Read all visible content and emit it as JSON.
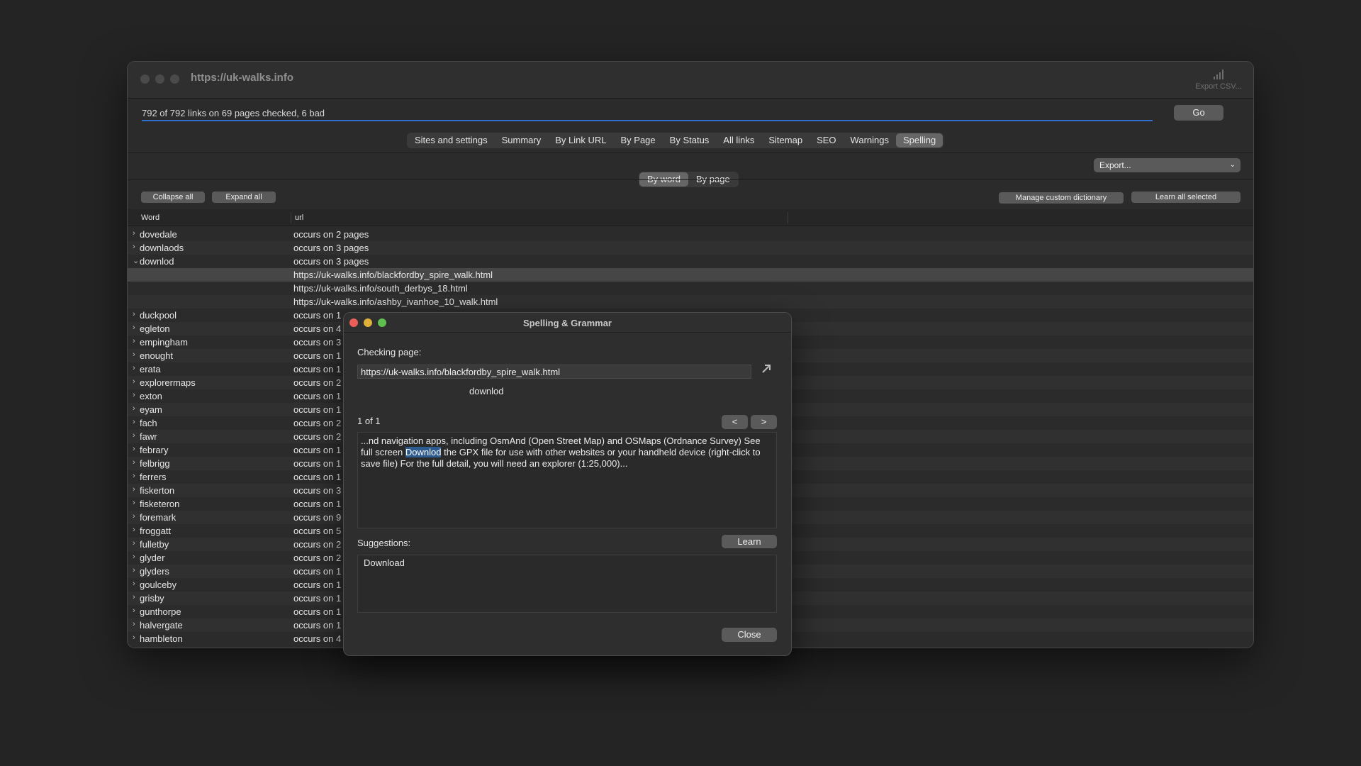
{
  "window": {
    "title": "https://uk-walks.info",
    "export_csv_label": "Export CSV...",
    "status": "792 of 792 links on 69 pages checked, 6 bad",
    "go_label": "Go"
  },
  "tabs": [
    "Sites and settings",
    "Summary",
    "By Link URL",
    "By Page",
    "By Status",
    "All links",
    "Sitemap",
    "SEO",
    "Warnings",
    "Spelling"
  ],
  "active_tab": "Spelling",
  "export_select": "Export...",
  "view_toggle": {
    "by_word": "By word",
    "by_page": "By page",
    "selected": "By word"
  },
  "buttons": {
    "collapse_all": "Collapse all",
    "expand_all": "Expand all",
    "manage_dictionary": "Manage custom dictionary",
    "learn_all_selected": "Learn all selected"
  },
  "columns": {
    "word": "Word",
    "url": "url"
  },
  "rows": [
    {
      "chev": "›",
      "word": "dovedale",
      "url": "occurs on 2 pages"
    },
    {
      "chev": "›",
      "word": "downlaods",
      "url": "occurs on 3 pages"
    },
    {
      "chev": "⌄",
      "word": "downlod",
      "url": "occurs on 3 pages"
    },
    {
      "chev": "",
      "word": "",
      "url": "https://uk-walks.info/blackfordby_spire_walk.html"
    },
    {
      "chev": "",
      "word": "",
      "url": "https://uk-walks.info/south_derbys_18.html"
    },
    {
      "chev": "",
      "word": "",
      "url": "https://uk-walks.info/ashby_ivanhoe_10_walk.html"
    },
    {
      "chev": "›",
      "word": "duckpool",
      "url": "occurs on 1"
    },
    {
      "chev": "›",
      "word": "egleton",
      "url": "occurs on 4"
    },
    {
      "chev": "›",
      "word": "empingham",
      "url": "occurs on 3"
    },
    {
      "chev": "›",
      "word": "enought",
      "url": "occurs on 1"
    },
    {
      "chev": "›",
      "word": "erata",
      "url": "occurs on 1"
    },
    {
      "chev": "›",
      "word": "explorermaps",
      "url": "occurs on 2"
    },
    {
      "chev": "›",
      "word": "exton",
      "url": "occurs on 1"
    },
    {
      "chev": "›",
      "word": "eyam",
      "url": "occurs on 1"
    },
    {
      "chev": "›",
      "word": "fach",
      "url": "occurs on 2"
    },
    {
      "chev": "›",
      "word": "fawr",
      "url": "occurs on 2"
    },
    {
      "chev": "›",
      "word": "febrary",
      "url": "occurs on 1"
    },
    {
      "chev": "›",
      "word": "felbrigg",
      "url": "occurs on 1"
    },
    {
      "chev": "›",
      "word": "ferrers",
      "url": "occurs on 1"
    },
    {
      "chev": "›",
      "word": "fiskerton",
      "url": "occurs on 3"
    },
    {
      "chev": "›",
      "word": "fisketeron",
      "url": "occurs on 1"
    },
    {
      "chev": "›",
      "word": "foremark",
      "url": "occurs on 9"
    },
    {
      "chev": "›",
      "word": "froggatt",
      "url": "occurs on 5"
    },
    {
      "chev": "›",
      "word": "fulletby",
      "url": "occurs on 2"
    },
    {
      "chev": "›",
      "word": "glyder",
      "url": "occurs on 2"
    },
    {
      "chev": "›",
      "word": "glyders",
      "url": "occurs on 1"
    },
    {
      "chev": "›",
      "word": "goulceby",
      "url": "occurs on 1"
    },
    {
      "chev": "›",
      "word": "grisby",
      "url": "occurs on 1"
    },
    {
      "chev": "›",
      "word": "gunthorpe",
      "url": "occurs on 1"
    },
    {
      "chev": "›",
      "word": "halvergate",
      "url": "occurs on 1"
    },
    {
      "chev": "›",
      "word": "hambleton",
      "url": "occurs on 4"
    }
  ],
  "selected_row": 3,
  "dialog": {
    "title": "Spelling & Grammar",
    "checking_label": "Checking page:",
    "page_url": "https://uk-walks.info/blackfordby_spire_walk.html",
    "word": "downlod",
    "counter": "1 of 1",
    "prev": "<",
    "next": ">",
    "context_before": "...nd navigation apps, including OsmAnd (Open Street Map) and OSMaps (Ordnance Survey) See full screen ",
    "context_word": "Downlod",
    "context_after": " the GPX file for use with other websites or your handheld device (right-click to save file) For the full detail, you will need an explorer (1:25,000)...",
    "suggestions_label": "Suggestions:",
    "learn_label": "Learn",
    "suggestions": [
      "Download"
    ],
    "close_label": "Close"
  },
  "colors": {
    "accent": "#2f6fd0",
    "close_light": "#ec5f58",
    "min_light": "#e0b13a",
    "max_light": "#5fc04f"
  }
}
